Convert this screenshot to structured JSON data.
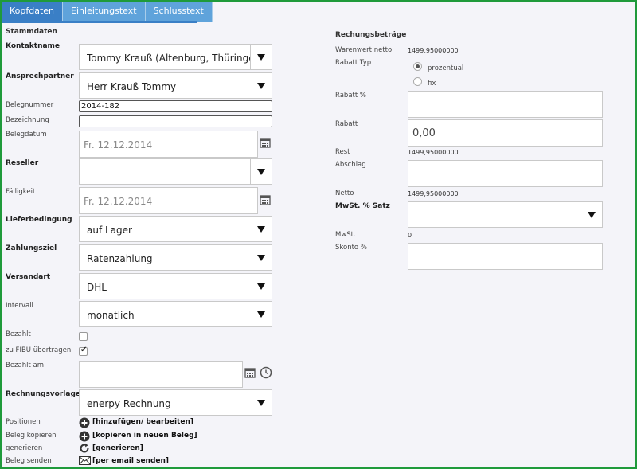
{
  "tabs": [
    "Kopfdaten",
    "Einleitungstext",
    "Schlusstext"
  ],
  "left": {
    "section": "Stammdaten",
    "kontaktname": {
      "label": "Kontaktname",
      "value": "Tommy Krauß (Altenburg, Thüringen), …"
    },
    "ansprechpartner": {
      "label": "Ansprechpartner",
      "value": "Herr Krauß Tommy"
    },
    "belegnummer": {
      "label": "Belegnummer",
      "value": "2014-182"
    },
    "bezeichnung": {
      "label": "Bezeichnung",
      "value": ""
    },
    "belegdatum": {
      "label": "Belegdatum",
      "value": "Fr. 12.12.2014"
    },
    "reseller": {
      "label": "Reseller",
      "value": ""
    },
    "faelligkeit": {
      "label": "Fälligkeit",
      "value": "Fr. 12.12.2014"
    },
    "lieferbedingung": {
      "label": "Lieferbedingung",
      "value": "auf Lager"
    },
    "zahlungsziel": {
      "label": "Zahlungsziel",
      "value": "Ratenzahlung"
    },
    "versandart": {
      "label": "Versandart",
      "value": "DHL"
    },
    "intervall": {
      "label": "Intervall",
      "value": "monatlich"
    },
    "bezahlt": {
      "label": "Bezahlt",
      "checked": false
    },
    "fibu": {
      "label": "zu FIBU übertragen",
      "checked": true
    },
    "bezahlt_am": {
      "label": "Bezahlt am",
      "value": ""
    },
    "rechnungsvorlage": {
      "label": "Rechnungsvorlage",
      "value": "enerpy Rechnung"
    },
    "positionen": {
      "label": "Positionen",
      "action": "[hinzufügen/ bearbeiten]"
    },
    "beleg_kopieren": {
      "label": "Beleg kopieren",
      "action": "[kopieren in neuen Beleg]"
    },
    "generieren": {
      "label": "generieren",
      "action": "[generieren]"
    },
    "beleg_senden": {
      "label": "Beleg senden",
      "action": "[per email senden]"
    }
  },
  "right": {
    "section": "Rechungsbeträge",
    "warenwert": {
      "label": "Warenwert netto",
      "value": "1499,95000000"
    },
    "rabatt_typ": {
      "label": "Rabatt Typ",
      "options": [
        "prozentual",
        "fix"
      ],
      "selected": "prozentual"
    },
    "rabatt_pct": {
      "label": "Rabatt %",
      "value": ""
    },
    "rabatt": {
      "label": "Rabatt",
      "value": "0,00"
    },
    "rest": {
      "label": "Rest",
      "value": "1499,95000000"
    },
    "abschlag": {
      "label": "Abschlag",
      "value": ""
    },
    "netto": {
      "label": "Netto",
      "value": "1499,95000000"
    },
    "mwst_satz": {
      "label": "MwSt. % Satz",
      "value": ""
    },
    "mwst": {
      "label": "MwSt.",
      "value": "0"
    },
    "skonto": {
      "label": "Skonto %",
      "value": ""
    }
  },
  "colors": {
    "frame": "#1f9a3b",
    "tab": "#5fa3db",
    "tab_active": "#3a7fc6",
    "background": "#f4f4f9"
  }
}
